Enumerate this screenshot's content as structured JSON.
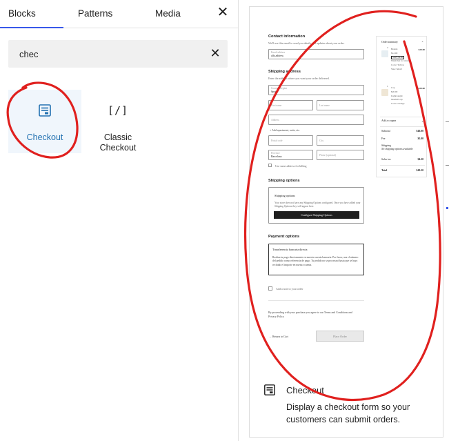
{
  "tabs": {
    "blocks": "Blocks",
    "patterns": "Patterns",
    "media": "Media",
    "close_symbol": "✕"
  },
  "search": {
    "value": "chec",
    "clear_symbol": "✕"
  },
  "results": [
    {
      "label": "Checkout",
      "icon": "checkout-form-icon",
      "selected": true
    },
    {
      "label": "Classic Checkout",
      "icon": "shortcode-bracket-icon",
      "glyph": "[/]"
    }
  ],
  "preview": {
    "contact": {
      "heading": "Contact information",
      "help": "We'll use this email to send you details and updates about your order.",
      "email_placeholder": "Email address",
      "email_value": "alfa.address"
    },
    "shipping": {
      "heading": "Shipping address",
      "help": "Enter the address where you want your order delivered.",
      "country_placeholder": "Country/Region",
      "country_value": "Spain",
      "first_name": "First name",
      "last_name": "Last name",
      "address": "Address",
      "add_more": "+ Add apartment, suite, etc.",
      "postal": "Postal code",
      "city": "City",
      "province_placeholder": "Province",
      "province_value": "Barcelona",
      "phone": "Phone (optional)",
      "same_billing": "Use same address for billing"
    },
    "shipping_options": {
      "heading": "Shipping options",
      "box_title": "Shipping options",
      "box_text": "Your store does not have any Shipping Options configured. Once you have added your Shipping Options they will appear here.",
      "button": "Configure Shipping Options"
    },
    "payment": {
      "heading": "Payment options",
      "method": "Transferencia bancaria directa",
      "desc": "Realiza tu pago directamente en nuestra cuenta bancaria. Por favor, usa el número del pedido como referencia de pago. Tu pedido no se procesará hasta que se haya recibido el importe en nuestra cuenta."
    },
    "note": "Add a note to your order",
    "terms": "By proceeding with your purchase you agree to our Terms and Conditions and Privacy Policy",
    "return": "← Return to Cart",
    "place_order": "Place Order",
    "summary": {
      "title": "Order summary",
      "items": [
        {
          "qty": "2",
          "name": "Beanie",
          "price": "$10.00",
          "meta1": "$12.00",
          "badge": "SAVE $2.00",
          "meta2": "Warm hat for winter",
          "meta3": "Color: Yellow",
          "meta4": "Size: Small",
          "total": "$20.00"
        },
        {
          "qty": "1",
          "name": "Cap",
          "price": "$20.00",
          "meta1": "Lightweight",
          "meta2": "baseball cap",
          "meta3": "Color: Orange",
          "total": "$20.00"
        }
      ],
      "coupon": "Add a coupon",
      "subtotal_label": "Subtotal",
      "subtotal": "$40.00",
      "fee_label": "Fee",
      "fee": "$5.00",
      "shipping_label": "Shipping",
      "shipping_note": "No shipping options available",
      "taxes_label": "Sales tax",
      "taxes": "$4.20",
      "total_label": "Total",
      "total": "$49.20"
    }
  },
  "info": {
    "title": "Checkout",
    "description": "Display a checkout form so your customers can submit orders."
  },
  "colors": {
    "accent": "#3858e9",
    "selected_bg": "#f0f6fc",
    "selected_text": "#2271b1",
    "annotation": "#e0201e"
  }
}
